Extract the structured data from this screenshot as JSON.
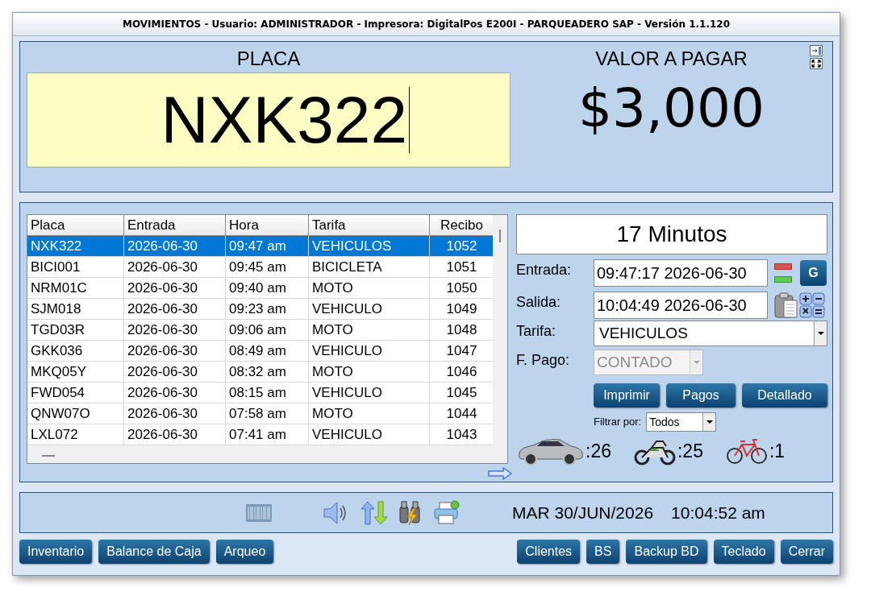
{
  "window": {
    "title": "MOVIMIENTOS - Usuario: ADMINISTRADOR - Impresora: DigitalPos E200I - PARQUEADERO SAP - Versión 1.1.120"
  },
  "plate": {
    "label": "PLACA",
    "value": "NXK322"
  },
  "amount": {
    "label": "VALOR A PAGAR",
    "value": "$3,000"
  },
  "table": {
    "columns": [
      "Placa",
      "Entrada",
      "Hora",
      "Tarifa",
      "Recibo"
    ],
    "rows": [
      {
        "cells": [
          "NXK322",
          "2026-06-30",
          "09:47 am",
          "VEHICULOS",
          "1052"
        ],
        "selected": true
      },
      {
        "cells": [
          "BICI001",
          "2026-06-30",
          "09:45 am",
          "BICICLETA",
          "1051"
        ],
        "selected": false
      },
      {
        "cells": [
          "NRM01C",
          "2026-06-30",
          "09:40 am",
          "MOTO",
          "1050"
        ],
        "selected": false
      },
      {
        "cells": [
          "SJM018",
          "2026-06-30",
          "09:23 am",
          "VEHICULO",
          "1049"
        ],
        "selected": false
      },
      {
        "cells": [
          "TGD03R",
          "2026-06-30",
          "09:06 am",
          "MOTO",
          "1048"
        ],
        "selected": false
      },
      {
        "cells": [
          "GKK036",
          "2026-06-30",
          "08:49 am",
          "VEHICULO",
          "1047"
        ],
        "selected": false
      },
      {
        "cells": [
          "MKQ05Y",
          "2026-06-30",
          "08:32 am",
          "MOTO",
          "1046"
        ],
        "selected": false
      },
      {
        "cells": [
          "FWD054",
          "2026-06-30",
          "08:15 am",
          "VEHICULO",
          "1045"
        ],
        "selected": false
      },
      {
        "cells": [
          "QNW07O",
          "2026-06-30",
          "07:58 am",
          "MOTO",
          "1044"
        ],
        "selected": false
      },
      {
        "cells": [
          "LXL072",
          "2026-06-30",
          "07:41 am",
          "VEHICULO",
          "1043"
        ],
        "selected": false
      }
    ]
  },
  "duration": "17 Minutos",
  "entrada": {
    "label": "Entrada:",
    "value": "09:47:17 2026-06-30",
    "button": "G"
  },
  "salida": {
    "label": "Salida:",
    "value": "10:04:49 2026-06-30"
  },
  "tarifa": {
    "label": "Tarifa:",
    "value": "VEHICULOS",
    "disabled": false
  },
  "pago": {
    "label": "F. Pago:",
    "value": "CONTADO",
    "disabled": true
  },
  "actions": [
    "Imprimir",
    "Pagos",
    "Detallado"
  ],
  "filter": {
    "label": "Filtrar por:",
    "value": "Todos"
  },
  "counts": [
    {
      "kind": "car",
      "value": ":26"
    },
    {
      "kind": "moto",
      "value": ":25"
    },
    {
      "kind": "bike",
      "value": ":1"
    }
  ],
  "status_bar": {
    "date": "MAR 30/JUN/2026",
    "time": "10:04:52 am"
  },
  "buttons_left": [
    "Inventario",
    "Balance de Caja",
    "Arqueo"
  ],
  "buttons_right": [
    "Clientes",
    "BS",
    "Backup BD",
    "Teclado",
    "Cerrar"
  ]
}
